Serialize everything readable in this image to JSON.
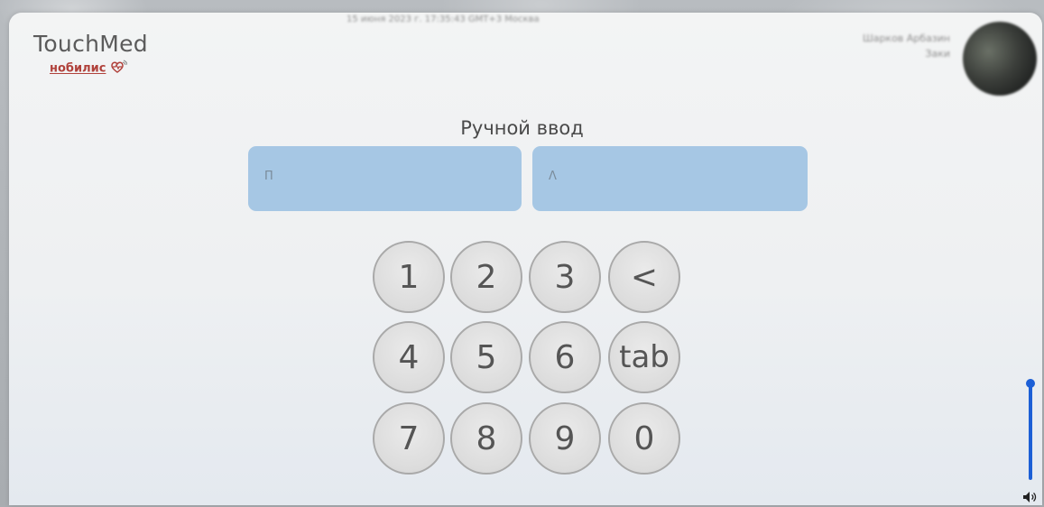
{
  "app": {
    "logo_title": "TouchMed",
    "logo_subtitle": "нобилис"
  },
  "header": {
    "datetime": "15 июня 2023 г. 17:35:43 GMT+3 Москва",
    "user_name": "Шарков Арбазин",
    "user_role": "Заки"
  },
  "form": {
    "title": "Ручной ввод",
    "field1_placeholder": "П",
    "field2_placeholder": "Λ"
  },
  "keypad": {
    "rows": [
      [
        "1",
        "2",
        "3",
        "<"
      ],
      [
        "4",
        "5",
        "6",
        "tab"
      ],
      [
        "7",
        "8",
        "9",
        "0"
      ]
    ]
  },
  "volume": {
    "level": 1.0,
    "icon": "speaker-icon"
  },
  "colors": {
    "field_bg": "#a6c7e4",
    "volume_accent": "#1c5fd6",
    "logo_accent": "#b0413b"
  }
}
